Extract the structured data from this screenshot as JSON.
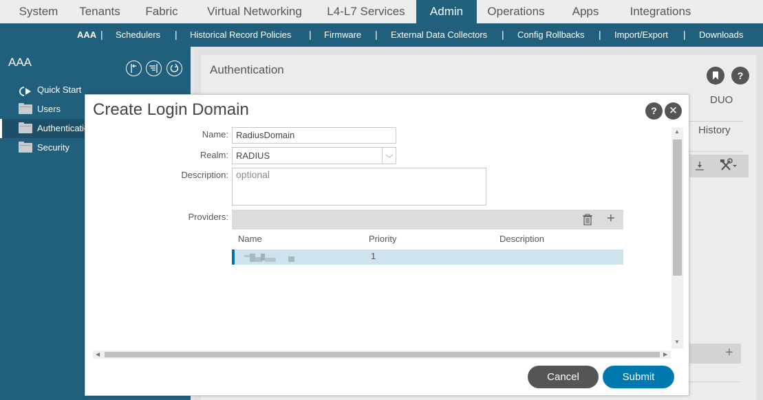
{
  "top_nav": {
    "tabs": [
      {
        "label": "System"
      },
      {
        "label": "Tenants"
      },
      {
        "label": "Fabric"
      },
      {
        "label": "Virtual Networking"
      },
      {
        "label": "L4-L7 Services"
      },
      {
        "label": "Admin",
        "active": true
      },
      {
        "label": "Operations"
      },
      {
        "label": "Apps"
      },
      {
        "label": "Integrations"
      }
    ]
  },
  "sub_nav": {
    "items": [
      {
        "label": "AAA",
        "active": true
      },
      {
        "label": "Schedulers"
      },
      {
        "label": "Historical Record Policies"
      },
      {
        "label": "Firmware"
      },
      {
        "label": "External Data Collectors"
      },
      {
        "label": "Config Rollbacks"
      },
      {
        "label": "Import/Export"
      },
      {
        "label": "Downloads"
      }
    ],
    "separator": "|"
  },
  "sidebar": {
    "title": "AAA",
    "toolbar_icons": [
      "collapse-left-icon",
      "filter-list-icon",
      "refresh-icon"
    ],
    "items": [
      {
        "label": "Quick Start",
        "icon": "quick-start-icon"
      },
      {
        "label": "Users",
        "icon": "folder-icon"
      },
      {
        "label": "Authentication",
        "icon": "folder-icon",
        "active": true
      },
      {
        "label": "Security",
        "icon": "folder-icon"
      }
    ]
  },
  "background_panel": {
    "title": "Authentication",
    "tabs": [
      "DUO",
      "History"
    ],
    "icons": {
      "bookmark": "bookmark-icon",
      "help": "?"
    }
  },
  "modal": {
    "title": "Create Login Domain",
    "help_label": "?",
    "close_label": "×",
    "fields": {
      "name": {
        "label": "Name:",
        "value": "RadiusDomain"
      },
      "realm": {
        "label": "Realm:",
        "value": "RADIUS"
      },
      "description": {
        "label": "Description:",
        "value": "",
        "placeholder": "optional"
      }
    },
    "providers": {
      "label": "Providers:",
      "columns": [
        "Name",
        "Priority",
        "Description"
      ],
      "rows": [
        {
          "name": "(redacted)",
          "priority": "1",
          "description": ""
        }
      ]
    },
    "buttons": {
      "cancel": "Cancel",
      "submit": "Submit"
    }
  },
  "colors": {
    "brand": "#21607d",
    "submit": "#0079b0",
    "cancel": "#555555",
    "selected_row": "#cde4ee",
    "row_indicator": "#0073a8"
  }
}
